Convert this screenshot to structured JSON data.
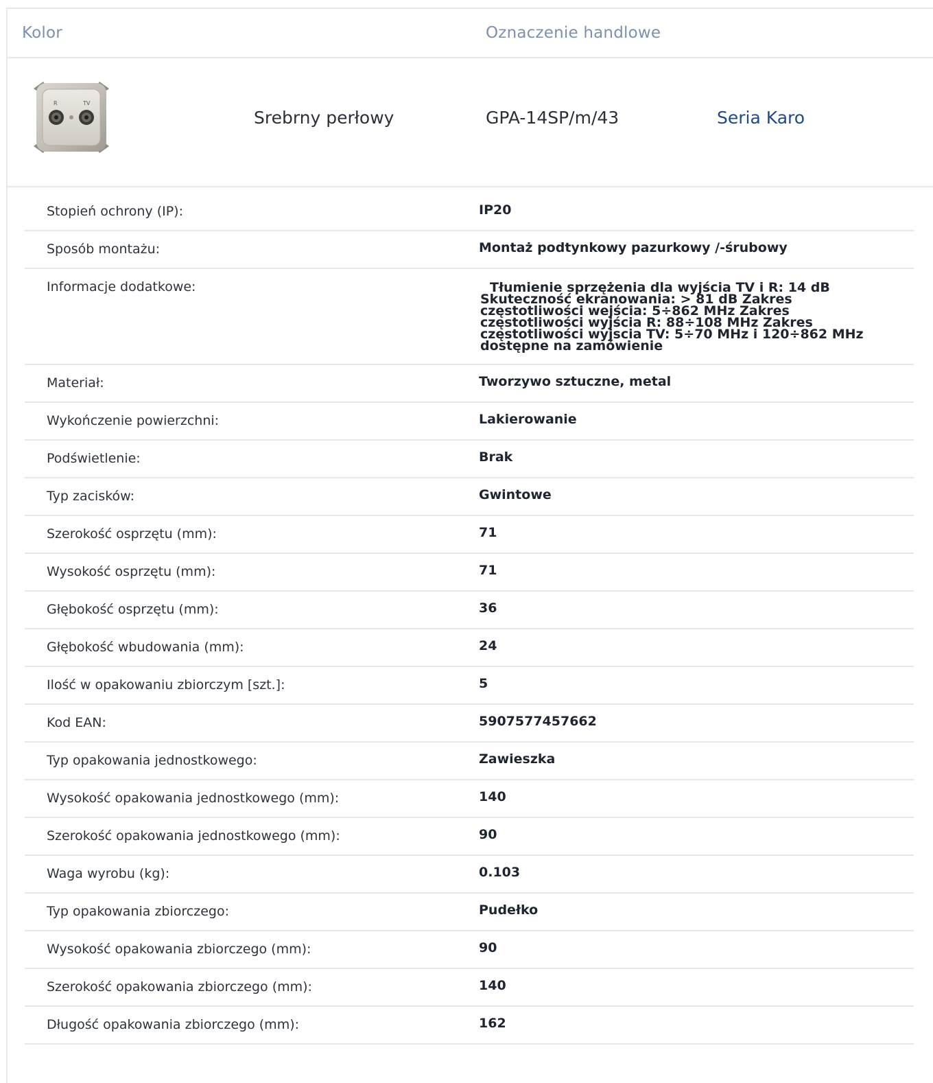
{
  "header": {
    "color_label": "Kolor",
    "trade_label": "Oznaczenie handlowe"
  },
  "product": {
    "color_value": "Srebrny perłowy",
    "trade_value": "GPA-14SP/m/43",
    "series_link": "Seria Karo",
    "thumb_labels": {
      "left": "R",
      "right": "TV"
    },
    "accent_color": "#1f4a86"
  },
  "specs": [
    {
      "label": "Stopień ochrony (IP):",
      "value": "IP20"
    },
    {
      "label": "Sposób montażu:",
      "value": "Montaż podtynkowy pazurkowy /-śrubowy"
    },
    {
      "label": "Informacje dodatkowe:",
      "value": "Tłumienie sprzężenia dla wyjścia TV i R: 14 dB Skuteczność ekranowania: > 81 dB Zakres częstotliwości wejścia: 5÷862 MHz Zakres częstotliwości wyjścia R: 88÷108 MHz Zakres częstotliwości wyjscia TV: 5÷70 MHz i 120÷862 MHz dostępne na zamówienie"
    },
    {
      "label": "Materiał:",
      "value": "Tworzywo sztuczne, metal"
    },
    {
      "label": "Wykończenie powierzchni:",
      "value": "Lakierowanie"
    },
    {
      "label": "Podświetlenie:",
      "value": "Brak"
    },
    {
      "label": "Typ zacisków:",
      "value": "Gwintowe"
    },
    {
      "label": "Szerokość osprzętu (mm):",
      "value": "71"
    },
    {
      "label": "Wysokość osprzętu (mm):",
      "value": "71"
    },
    {
      "label": "Głębokość osprzętu (mm):",
      "value": "36"
    },
    {
      "label": "Głębokość wbudowania (mm):",
      "value": "24"
    },
    {
      "label": "Ilość w opakowaniu zbiorczym [szt.]:",
      "value": "5"
    },
    {
      "label": "Kod EAN:",
      "value": "5907577457662"
    },
    {
      "label": "Typ opakowania jednostkowego:",
      "value": "Zawieszka"
    },
    {
      "label": "Wysokość opakowania jednostkowego (mm):",
      "value": "140"
    },
    {
      "label": "Szerokość opakowania jednostkowego (mm):",
      "value": "90"
    },
    {
      "label": "Waga wyrobu (kg):",
      "value": "0.103"
    },
    {
      "label": "Typ opakowania zbiorczego:",
      "value": "Pudełko"
    },
    {
      "label": "Wysokość opakowania zbiorczego (mm):",
      "value": "90"
    },
    {
      "label": "Szerokość opakowania zbiorczego (mm):",
      "value": "140"
    },
    {
      "label": "Długość opakowania zbiorczego (mm):",
      "value": "162"
    }
  ]
}
